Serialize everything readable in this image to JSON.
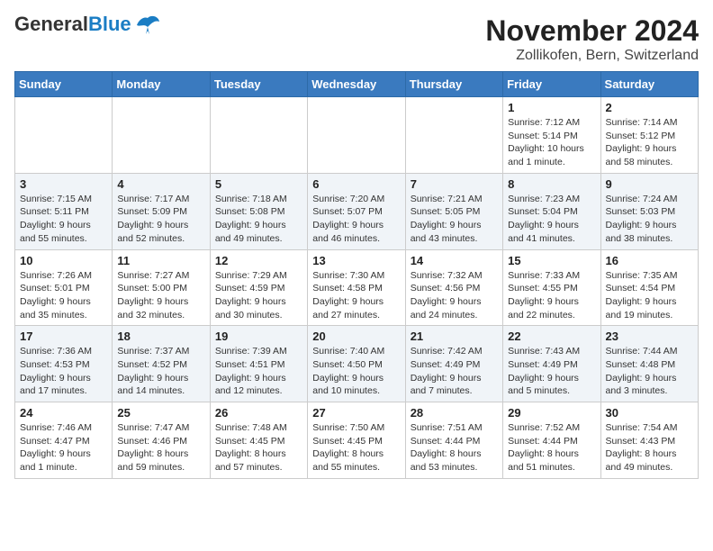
{
  "header": {
    "logo_general": "General",
    "logo_blue": "Blue",
    "title": "November 2024",
    "subtitle": "Zollikofen, Bern, Switzerland"
  },
  "weekdays": [
    "Sunday",
    "Monday",
    "Tuesday",
    "Wednesday",
    "Thursday",
    "Friday",
    "Saturday"
  ],
  "weeks": [
    [
      {
        "day": "",
        "info": ""
      },
      {
        "day": "",
        "info": ""
      },
      {
        "day": "",
        "info": ""
      },
      {
        "day": "",
        "info": ""
      },
      {
        "day": "",
        "info": ""
      },
      {
        "day": "1",
        "info": "Sunrise: 7:12 AM\nSunset: 5:14 PM\nDaylight: 10 hours and 1 minute."
      },
      {
        "day": "2",
        "info": "Sunrise: 7:14 AM\nSunset: 5:12 PM\nDaylight: 9 hours and 58 minutes."
      }
    ],
    [
      {
        "day": "3",
        "info": "Sunrise: 7:15 AM\nSunset: 5:11 PM\nDaylight: 9 hours and 55 minutes."
      },
      {
        "day": "4",
        "info": "Sunrise: 7:17 AM\nSunset: 5:09 PM\nDaylight: 9 hours and 52 minutes."
      },
      {
        "day": "5",
        "info": "Sunrise: 7:18 AM\nSunset: 5:08 PM\nDaylight: 9 hours and 49 minutes."
      },
      {
        "day": "6",
        "info": "Sunrise: 7:20 AM\nSunset: 5:07 PM\nDaylight: 9 hours and 46 minutes."
      },
      {
        "day": "7",
        "info": "Sunrise: 7:21 AM\nSunset: 5:05 PM\nDaylight: 9 hours and 43 minutes."
      },
      {
        "day": "8",
        "info": "Sunrise: 7:23 AM\nSunset: 5:04 PM\nDaylight: 9 hours and 41 minutes."
      },
      {
        "day": "9",
        "info": "Sunrise: 7:24 AM\nSunset: 5:03 PM\nDaylight: 9 hours and 38 minutes."
      }
    ],
    [
      {
        "day": "10",
        "info": "Sunrise: 7:26 AM\nSunset: 5:01 PM\nDaylight: 9 hours and 35 minutes."
      },
      {
        "day": "11",
        "info": "Sunrise: 7:27 AM\nSunset: 5:00 PM\nDaylight: 9 hours and 32 minutes."
      },
      {
        "day": "12",
        "info": "Sunrise: 7:29 AM\nSunset: 4:59 PM\nDaylight: 9 hours and 30 minutes."
      },
      {
        "day": "13",
        "info": "Sunrise: 7:30 AM\nSunset: 4:58 PM\nDaylight: 9 hours and 27 minutes."
      },
      {
        "day": "14",
        "info": "Sunrise: 7:32 AM\nSunset: 4:56 PM\nDaylight: 9 hours and 24 minutes."
      },
      {
        "day": "15",
        "info": "Sunrise: 7:33 AM\nSunset: 4:55 PM\nDaylight: 9 hours and 22 minutes."
      },
      {
        "day": "16",
        "info": "Sunrise: 7:35 AM\nSunset: 4:54 PM\nDaylight: 9 hours and 19 minutes."
      }
    ],
    [
      {
        "day": "17",
        "info": "Sunrise: 7:36 AM\nSunset: 4:53 PM\nDaylight: 9 hours and 17 minutes."
      },
      {
        "day": "18",
        "info": "Sunrise: 7:37 AM\nSunset: 4:52 PM\nDaylight: 9 hours and 14 minutes."
      },
      {
        "day": "19",
        "info": "Sunrise: 7:39 AM\nSunset: 4:51 PM\nDaylight: 9 hours and 12 minutes."
      },
      {
        "day": "20",
        "info": "Sunrise: 7:40 AM\nSunset: 4:50 PM\nDaylight: 9 hours and 10 minutes."
      },
      {
        "day": "21",
        "info": "Sunrise: 7:42 AM\nSunset: 4:49 PM\nDaylight: 9 hours and 7 minutes."
      },
      {
        "day": "22",
        "info": "Sunrise: 7:43 AM\nSunset: 4:49 PM\nDaylight: 9 hours and 5 minutes."
      },
      {
        "day": "23",
        "info": "Sunrise: 7:44 AM\nSunset: 4:48 PM\nDaylight: 9 hours and 3 minutes."
      }
    ],
    [
      {
        "day": "24",
        "info": "Sunrise: 7:46 AM\nSunset: 4:47 PM\nDaylight: 9 hours and 1 minute."
      },
      {
        "day": "25",
        "info": "Sunrise: 7:47 AM\nSunset: 4:46 PM\nDaylight: 8 hours and 59 minutes."
      },
      {
        "day": "26",
        "info": "Sunrise: 7:48 AM\nSunset: 4:45 PM\nDaylight: 8 hours and 57 minutes."
      },
      {
        "day": "27",
        "info": "Sunrise: 7:50 AM\nSunset: 4:45 PM\nDaylight: 8 hours and 55 minutes."
      },
      {
        "day": "28",
        "info": "Sunrise: 7:51 AM\nSunset: 4:44 PM\nDaylight: 8 hours and 53 minutes."
      },
      {
        "day": "29",
        "info": "Sunrise: 7:52 AM\nSunset: 4:44 PM\nDaylight: 8 hours and 51 minutes."
      },
      {
        "day": "30",
        "info": "Sunrise: 7:54 AM\nSunset: 4:43 PM\nDaylight: 8 hours and 49 minutes."
      }
    ]
  ]
}
